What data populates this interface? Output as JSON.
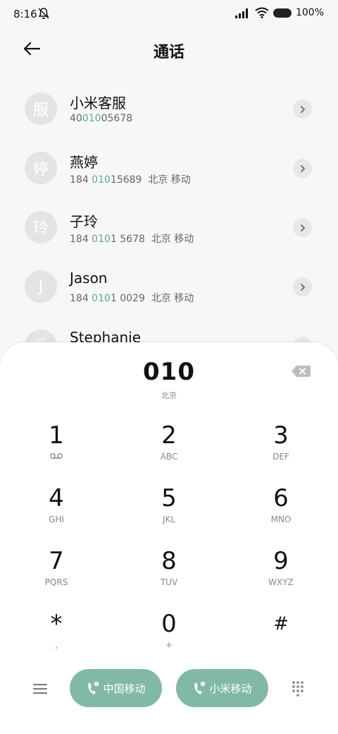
{
  "status_bar": {
    "time": "8:16",
    "battery": "100%"
  },
  "header": {
    "title": "通话"
  },
  "contacts": [
    {
      "avatar": "服",
      "name": "小米客服",
      "num_pre": "40",
      "num_hl": "010",
      "num_post": "05678",
      "location": ""
    },
    {
      "avatar": "婷",
      "name": "燕婷",
      "num_pre": "184 ",
      "num_hl": "010",
      "num_post": "15689",
      "location": "北京 移动"
    },
    {
      "avatar": "玲",
      "name": "子玲",
      "num_pre": "184 ",
      "num_hl": "010",
      "num_post": "1 5678",
      "location": "北京 移动"
    },
    {
      "avatar": "J",
      "name": "Jason",
      "num_pre": "184 ",
      "num_hl": "010",
      "num_post": "1 0029",
      "location": "北京 移动"
    },
    {
      "avatar": "S",
      "name": "Stephanie",
      "num_pre": "",
      "num_hl": "",
      "num_post": "",
      "location": ""
    }
  ],
  "dialer": {
    "number": "010",
    "location": "北京",
    "keys": [
      {
        "digit": "1",
        "letters": ""
      },
      {
        "digit": "2",
        "letters": "ABC"
      },
      {
        "digit": "3",
        "letters": "DEF"
      },
      {
        "digit": "4",
        "letters": "GHI"
      },
      {
        "digit": "5",
        "letters": "JKL"
      },
      {
        "digit": "6",
        "letters": "MNO"
      },
      {
        "digit": "7",
        "letters": "PQRS"
      },
      {
        "digit": "8",
        "letters": "TUV"
      },
      {
        "digit": "9",
        "letters": "WXYZ"
      },
      {
        "digit": "*",
        "letters": ","
      },
      {
        "digit": "0",
        "letters": "+"
      },
      {
        "digit": "#",
        "letters": ""
      }
    ],
    "sim1_label": "中国移动",
    "sim2_label": "小米移动"
  },
  "colors": {
    "accent": "#82b9a5",
    "highlight": "#5fa892"
  }
}
